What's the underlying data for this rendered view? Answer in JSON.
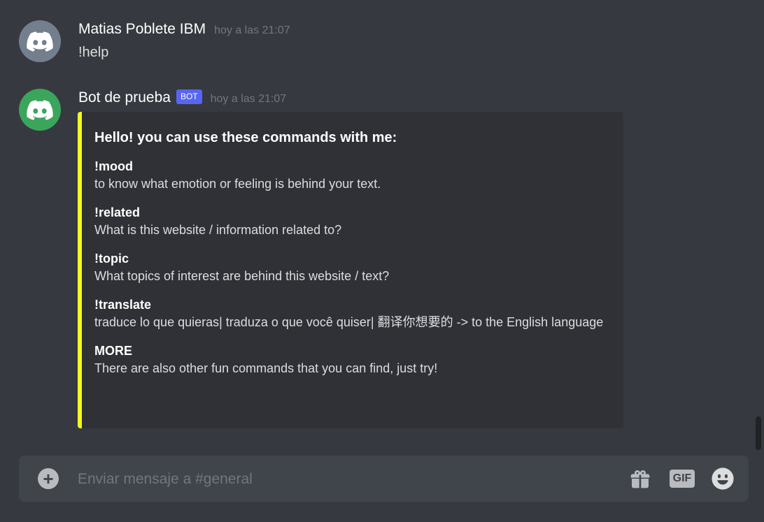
{
  "messages": [
    {
      "username": "Matias Poblete  IBM",
      "timestamp": "hoy a las 21:07",
      "content": "!help",
      "avatar_icon": "discord-logo-icon",
      "avatar_color": "#747f8d"
    },
    {
      "username": "Bot de prueba",
      "bot_tag": "BOT",
      "timestamp": "hoy a las 21:07",
      "avatar_icon": "discord-logo-icon",
      "avatar_color": "#3ba55c",
      "embed": {
        "accent_color": "#f2fb1e",
        "title": "Hello! you can use these commands with me:",
        "fields": [
          {
            "name": "!mood",
            "value": "to know what emotion or feeling is behind your text."
          },
          {
            "name": "!related",
            "value": "What is this website / information related to?"
          },
          {
            "name": "!topic",
            "value": "What topics of interest are behind this website / text?"
          },
          {
            "name": "!translate",
            "value": "traduce lo que quieras| traduza o que você quiser| 翻译你想要的 -> to the English language"
          },
          {
            "name": "MORE",
            "value": "There are also other fun commands that you can find, just try!"
          }
        ]
      }
    }
  ],
  "composer": {
    "placeholder": "Enviar mensaje a #general",
    "add_icon": "plus-circle-icon",
    "gift_icon": "gift-icon",
    "gif_label": "GIF",
    "emoji_icon": "emoji-icon"
  },
  "colors": {
    "background": "#36393f",
    "embed_background": "#2f3136",
    "composer_background": "#40444b",
    "bot_tag": "#5865f2"
  }
}
